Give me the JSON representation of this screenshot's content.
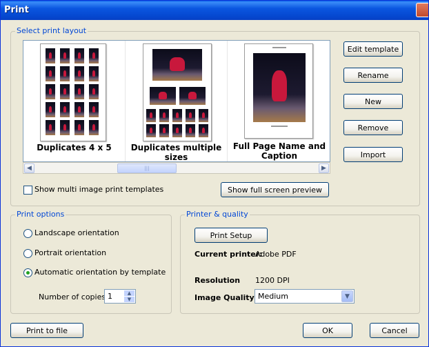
{
  "window": {
    "title": "Print"
  },
  "layout_group": {
    "label": "Select print layout",
    "templates": [
      {
        "label": "Duplicates 4 x 5"
      },
      {
        "label": "Duplicates multiple sizes"
      },
      {
        "label": "Full Page Name and Caption"
      }
    ],
    "show_multi_label": "Show multi image print templates",
    "show_multi_checked": false,
    "preview_button": "Show full screen preview"
  },
  "side_buttons": {
    "edit": "Edit template",
    "rename": "Rename",
    "new": "New",
    "remove": "Remove",
    "import": "Import"
  },
  "print_options": {
    "label": "Print options",
    "landscape": "Landscape orientation",
    "portrait": "Portrait orientation",
    "automatic": "Automatic orientation by template",
    "selected": "automatic",
    "copies_label": "Number of copies",
    "copies_value": "1"
  },
  "printer_quality": {
    "label": "Printer & quality",
    "setup_button": "Print Setup",
    "current_printer_label": "Current printer:",
    "current_printer_value": "Adobe PDF",
    "resolution_label": "Resolution",
    "resolution_value": "1200 DPI",
    "image_quality_label": "Image Quality:",
    "image_quality_value": "Medium"
  },
  "footer": {
    "print_to_file": "Print to file",
    "ok": "OK",
    "cancel": "Cancel"
  }
}
